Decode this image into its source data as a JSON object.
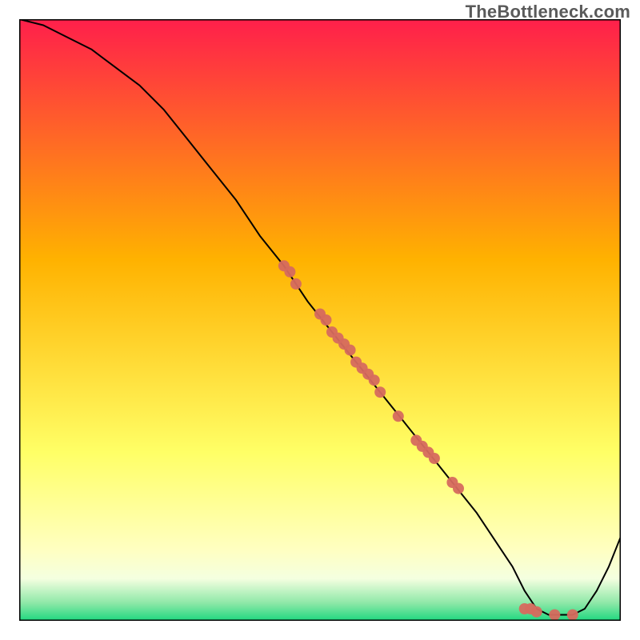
{
  "watermark": "TheBottleneck.com",
  "chart_data": {
    "type": "line",
    "title": "",
    "xlabel": "",
    "ylabel": "",
    "xlim": [
      0,
      100
    ],
    "ylim": [
      0,
      100
    ],
    "grid": false,
    "legend": false,
    "colors": {
      "line": "#000000",
      "markers": "#d66a5e",
      "gradient_top": "#ff1f4b",
      "gradient_mid_upper": "#ffb200",
      "gradient_mid_lower": "#ffff66",
      "gradient_band_pale": "#f4ffe0",
      "gradient_bottom": "#1fd87f",
      "border": "#000000"
    },
    "series": [
      {
        "name": "curve",
        "x": [
          0,
          4,
          8,
          12,
          16,
          20,
          24,
          28,
          32,
          36,
          40,
          44,
          48,
          52,
          56,
          60,
          64,
          68,
          72,
          76,
          80,
          82,
          84,
          86,
          88,
          90,
          92,
          94,
          96,
          98,
          100
        ],
        "y": [
          100,
          99,
          97,
          95,
          92,
          89,
          85,
          80,
          75,
          70,
          64,
          59,
          53,
          48,
          43,
          38,
          33,
          28,
          23,
          18,
          12,
          9,
          5,
          2,
          1,
          1,
          1,
          2,
          5,
          9,
          14
        ]
      }
    ],
    "markers": [
      {
        "x": 44,
        "y": 59
      },
      {
        "x": 45,
        "y": 58
      },
      {
        "x": 46,
        "y": 56
      },
      {
        "x": 50,
        "y": 51
      },
      {
        "x": 51,
        "y": 50
      },
      {
        "x": 52,
        "y": 48
      },
      {
        "x": 53,
        "y": 47
      },
      {
        "x": 54,
        "y": 46
      },
      {
        "x": 55,
        "y": 45
      },
      {
        "x": 56,
        "y": 43
      },
      {
        "x": 57,
        "y": 42
      },
      {
        "x": 58,
        "y": 41
      },
      {
        "x": 59,
        "y": 40
      },
      {
        "x": 60,
        "y": 38
      },
      {
        "x": 63,
        "y": 34
      },
      {
        "x": 66,
        "y": 30
      },
      {
        "x": 67,
        "y": 29
      },
      {
        "x": 68,
        "y": 28
      },
      {
        "x": 69,
        "y": 27
      },
      {
        "x": 72,
        "y": 23
      },
      {
        "x": 73,
        "y": 22
      },
      {
        "x": 84,
        "y": 2
      },
      {
        "x": 85,
        "y": 2
      },
      {
        "x": 86,
        "y": 1.5
      },
      {
        "x": 89,
        "y": 1
      },
      {
        "x": 92,
        "y": 1
      }
    ]
  }
}
